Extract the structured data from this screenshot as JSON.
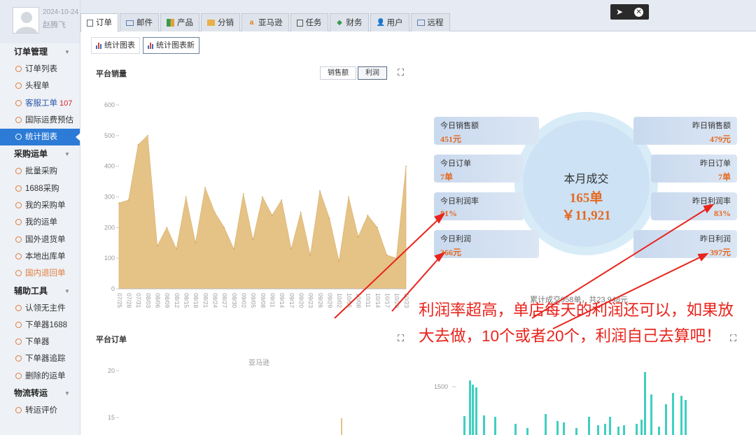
{
  "user": {
    "date": "2024-10-24",
    "name": "赵腾飞"
  },
  "sidebar": {
    "sections": [
      {
        "title": "订单管理",
        "items": [
          {
            "label": "订单列表",
            "badge": ""
          },
          {
            "label": "头程单",
            "badge": ""
          },
          {
            "label": "客服工单",
            "badge": "107"
          },
          {
            "label": "国际运费预估",
            "badge": ""
          },
          {
            "label": "统计图表",
            "badge": ""
          }
        ]
      },
      {
        "title": "采购运单",
        "items": [
          {
            "label": "批量采购"
          },
          {
            "label": "1688采购"
          },
          {
            "label": "我的采购单"
          },
          {
            "label": "我的运单"
          },
          {
            "label": "国外退货单"
          },
          {
            "label": "本地出库单"
          },
          {
            "label": "国内退回单"
          }
        ]
      },
      {
        "title": "辅助工具",
        "items": [
          {
            "label": "认领无主件"
          },
          {
            "label": "下单器1688"
          },
          {
            "label": "下单器"
          },
          {
            "label": "下单器追踪"
          },
          {
            "label": "删除的运单"
          }
        ]
      },
      {
        "title": "物流转运",
        "items": [
          {
            "label": "转运评价"
          }
        ]
      }
    ]
  },
  "tabs": [
    "订单",
    "邮件",
    "产品",
    "分销",
    "亚马逊",
    "任务",
    "财务",
    "用户",
    "远程"
  ],
  "subtabs": [
    "统计图表",
    "统计图表新"
  ],
  "sales_panel": {
    "title": "平台销量",
    "toggle_sales": "销售额",
    "toggle_profit": "利润"
  },
  "orders_panel": {
    "title": "平台订单",
    "series_name": "亚马逊"
  },
  "stats": {
    "center_title": "本月成交",
    "center_orders": "165单",
    "center_amount": "￥11,921",
    "today_sales_label": "今日销售额",
    "today_sales": "451元",
    "yesterday_sales_label": "昨日销售额",
    "yesterday_sales": "479元",
    "today_orders_label": "今日订单",
    "today_orders": "7单",
    "yesterday_orders_label": "昨日订单",
    "yesterday_orders": "7单",
    "today_rate_label": "今日利润率",
    "today_rate": "81%",
    "yesterday_rate_label": "昨日利润率",
    "yesterday_rate": "83%",
    "today_profit_label": "今日利润",
    "today_profit": "366元",
    "yesterday_profit_label": "昨日利润",
    "yesterday_profit": "397元",
    "cumulative": "累计成交958单，共23,948元"
  },
  "annotation": "利润率超高，单店每天的利润还可以，如果放大去做，10个或者20个，利润自己去算吧！",
  "colors": {
    "area": "#e5c286",
    "accent": "#2c7bd6",
    "value": "#e46a22",
    "annotation": "#e8241c",
    "bars": "#3fcfbf"
  },
  "chart_data": [
    {
      "type": "area",
      "title": "平台销量",
      "ylim": [
        0,
        600
      ],
      "yticks": [
        0,
        100,
        200,
        300,
        400,
        500,
        600
      ],
      "x": [
        "07/25",
        "07/28",
        "07/31",
        "08/03",
        "08/06",
        "08/09",
        "08/12",
        "08/15",
        "08/18",
        "08/21",
        "08/24",
        "08/27",
        "08/30",
        "09/02",
        "09/05",
        "09/08",
        "09/11",
        "09/14",
        "09/17",
        "09/20",
        "09/23",
        "09/26",
        "09/29",
        "10/02",
        "10/05",
        "10/08",
        "10/11",
        "10/14",
        "10/17",
        "10/20",
        "10/23"
      ],
      "values": [
        280,
        290,
        470,
        500,
        140,
        200,
        130,
        300,
        150,
        330,
        250,
        200,
        130,
        310,
        160,
        300,
        240,
        290,
        130,
        250,
        110,
        320,
        230,
        90,
        300,
        170,
        240,
        200,
        110,
        100,
        400
      ]
    },
    {
      "type": "line",
      "title": "平台订单",
      "series": [
        {
          "name": "亚马逊"
        }
      ],
      "yticks": [
        15,
        20
      ]
    },
    {
      "type": "bar",
      "yticks": [
        1500
      ]
    }
  ]
}
